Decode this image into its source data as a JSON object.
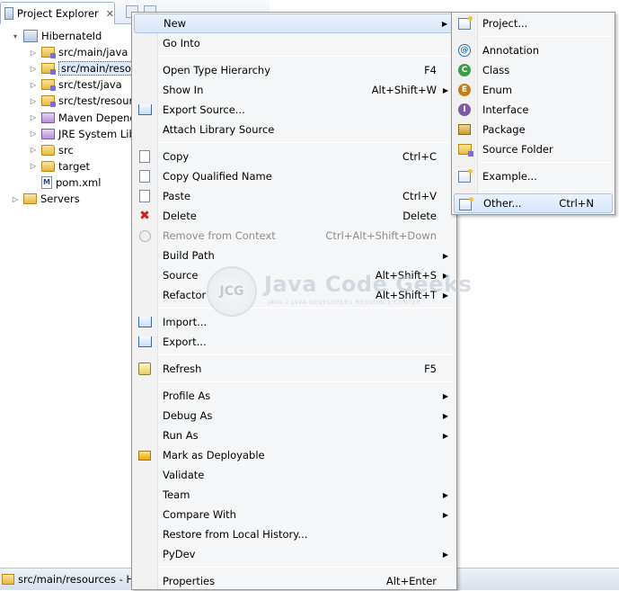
{
  "explorer": {
    "tab_title": "Project Explorer",
    "close_glyph": "✕",
    "tree": [
      {
        "label": "HibernateId",
        "icon": "java-project-icon",
        "indent": 0,
        "twisty": "▾"
      },
      {
        "label": "src/main/java",
        "icon": "source-folder-icon",
        "indent": 1,
        "twisty": "▷"
      },
      {
        "label": "src/main/resou",
        "icon": "source-folder-icon",
        "indent": 1,
        "twisty": "▷",
        "selected": true
      },
      {
        "label": "src/test/java",
        "icon": "source-folder-icon",
        "indent": 1,
        "twisty": "▷"
      },
      {
        "label": "src/test/resour",
        "icon": "source-folder-icon",
        "indent": 1,
        "twisty": "▷"
      },
      {
        "label": "Maven Depend",
        "icon": "library-icon",
        "indent": 1,
        "twisty": "▷"
      },
      {
        "label": "JRE System Libr",
        "icon": "library-icon",
        "indent": 1,
        "twisty": "▷"
      },
      {
        "label": "src",
        "icon": "folder-icon",
        "indent": 1,
        "twisty": "▷"
      },
      {
        "label": "target",
        "icon": "folder-icon",
        "indent": 1,
        "twisty": "▷"
      },
      {
        "label": "pom.xml",
        "icon": "maven-file-icon",
        "indent": 1,
        "twisty": ""
      },
      {
        "label": "Servers",
        "icon": "server-folder-icon",
        "indent": 0,
        "twisty": "▷"
      }
    ]
  },
  "status_bar": {
    "text": "src/main/resources - Hib"
  },
  "watermark": {
    "logo_text": "JCG",
    "title": "Java Code Geeks",
    "tagline": "JAVA 2 JAVA DEVELOPERS RESOURCE CENTER"
  },
  "context_menu": {
    "items": [
      {
        "label": "New",
        "shortcut": "",
        "submenu": true,
        "highlighted": true
      },
      {
        "label": "Go Into",
        "shortcut": ""
      },
      {
        "sep": true
      },
      {
        "label": "Open Type Hierarchy",
        "shortcut": "F4"
      },
      {
        "label": "Show In",
        "shortcut": "Alt+Shift+W",
        "submenu": true
      },
      {
        "label": "Export Source...",
        "shortcut": "",
        "icon": "export-source-icon"
      },
      {
        "label": "Attach Library Source",
        "shortcut": ""
      },
      {
        "sep": true
      },
      {
        "label": "Copy",
        "shortcut": "Ctrl+C",
        "icon": "copy-icon"
      },
      {
        "label": "Copy Qualified Name",
        "shortcut": "",
        "icon": "copy-qualified-icon"
      },
      {
        "label": "Paste",
        "shortcut": "Ctrl+V",
        "icon": "paste-icon"
      },
      {
        "label": "Delete",
        "shortcut": "Delete",
        "icon": "delete-icon"
      },
      {
        "label": "Remove from Context",
        "shortcut": "Ctrl+Alt+Shift+Down",
        "icon": "remove-context-icon",
        "disabled": true
      },
      {
        "label": "Build Path",
        "shortcut": "",
        "submenu": true
      },
      {
        "label": "Source",
        "shortcut": "Alt+Shift+S",
        "submenu": true
      },
      {
        "label": "Refactor",
        "shortcut": "Alt+Shift+T",
        "submenu": true
      },
      {
        "sep": true
      },
      {
        "label": "Import...",
        "shortcut": "",
        "icon": "import-icon"
      },
      {
        "label": "Export...",
        "shortcut": "",
        "icon": "export-icon"
      },
      {
        "sep": true
      },
      {
        "label": "Refresh",
        "shortcut": "F5",
        "icon": "refresh-icon"
      },
      {
        "sep": true
      },
      {
        "label": "Profile As",
        "shortcut": "",
        "submenu": true
      },
      {
        "label": "Debug As",
        "shortcut": "",
        "submenu": true
      },
      {
        "label": "Run As",
        "shortcut": "",
        "submenu": true
      },
      {
        "label": "Mark as Deployable",
        "shortcut": "",
        "icon": "deployable-icon"
      },
      {
        "label": "Validate",
        "shortcut": ""
      },
      {
        "label": "Team",
        "shortcut": "",
        "submenu": true
      },
      {
        "label": "Compare With",
        "shortcut": "",
        "submenu": true
      },
      {
        "label": "Restore from Local History...",
        "shortcut": ""
      },
      {
        "label": "PyDev",
        "shortcut": "",
        "submenu": true
      },
      {
        "sep": true
      },
      {
        "label": "Properties",
        "shortcut": "Alt+Enter"
      }
    ]
  },
  "new_submenu": {
    "items": [
      {
        "label": "Project...",
        "shortcut": "",
        "icon": "new-project-icon"
      },
      {
        "sep": true
      },
      {
        "label": "Annotation",
        "shortcut": "",
        "icon": "annotation-icon",
        "glyph": "@"
      },
      {
        "label": "Class",
        "shortcut": "",
        "icon": "class-icon",
        "glyph": "C"
      },
      {
        "label": "Enum",
        "shortcut": "",
        "icon": "enum-icon",
        "glyph": "E"
      },
      {
        "label": "Interface",
        "shortcut": "",
        "icon": "interface-icon",
        "glyph": "I"
      },
      {
        "label": "Package",
        "shortcut": "",
        "icon": "package-icon"
      },
      {
        "label": "Source Folder",
        "shortcut": "",
        "icon": "source-folder-icon"
      },
      {
        "sep": true
      },
      {
        "label": "Example...",
        "shortcut": "",
        "icon": "example-icon"
      },
      {
        "sep": true
      },
      {
        "label": "Other...",
        "shortcut": "Ctrl+N",
        "icon": "other-wizard-icon",
        "highlighted": true
      }
    ]
  }
}
